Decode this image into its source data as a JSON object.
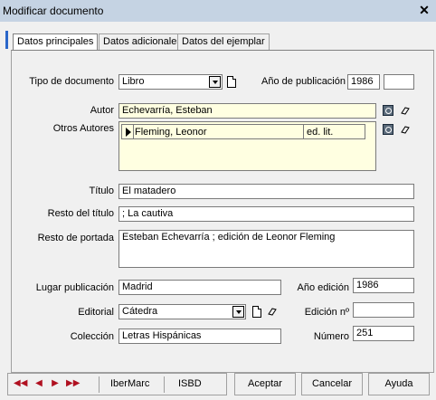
{
  "window": {
    "title": "Modificar documento",
    "close": "✕"
  },
  "tabs": [
    {
      "label": "Datos principales",
      "active": true
    },
    {
      "label": "Datos adicionales",
      "active": false
    },
    {
      "label": "Datos del ejemplar",
      "active": false
    }
  ],
  "form": {
    "tipo_label": "Tipo de documento",
    "tipo_value": "Libro",
    "anio_pub_label": "Año de publicación",
    "anio_pub_value": "1986",
    "anio_pub_extra": "",
    "autor_label": "Autor",
    "autor_value": "Echevarría, Esteban",
    "otros_label": "Otros Autores",
    "otros_name": "Fleming, Leonor",
    "otros_role": "ed. lit.",
    "titulo_label": "Título",
    "titulo_value": "El matadero",
    "resto_titulo_label": "Resto del título",
    "resto_titulo_value": "; La cautiva",
    "resto_portada_label": "Resto de portada",
    "resto_portada_value": "Esteban Echevarría ; edición de Leonor Fleming",
    "lugar_label": "Lugar publicación",
    "lugar_value": "Madrid",
    "anio_ed_label": "Año edición",
    "anio_ed_value": "1986",
    "editorial_label": "Editorial",
    "editorial_value": "Cátedra",
    "edicion_label": "Edición nº",
    "edicion_value": "",
    "coleccion_label": "Colección",
    "coleccion_value": "Letras Hispánicas",
    "numero_label": "Número",
    "numero_value": "251"
  },
  "footer": {
    "nav_first": "◀◀",
    "nav_prev": "◀",
    "nav_next": "▶",
    "nav_last": "▶▶",
    "ibermarc": "IberMarc",
    "isbd": "ISBD",
    "aceptar": "Aceptar",
    "cancelar": "Cancelar",
    "ayuda": "Ayuda"
  },
  "icons": {
    "doc": "document-icon",
    "eraser": "eraser-icon",
    "search": "search-icon"
  },
  "colors": {
    "titlebar": "#c5d3e3",
    "highlight_field": "#ffffe1",
    "nav_arrows": "#b01020"
  }
}
